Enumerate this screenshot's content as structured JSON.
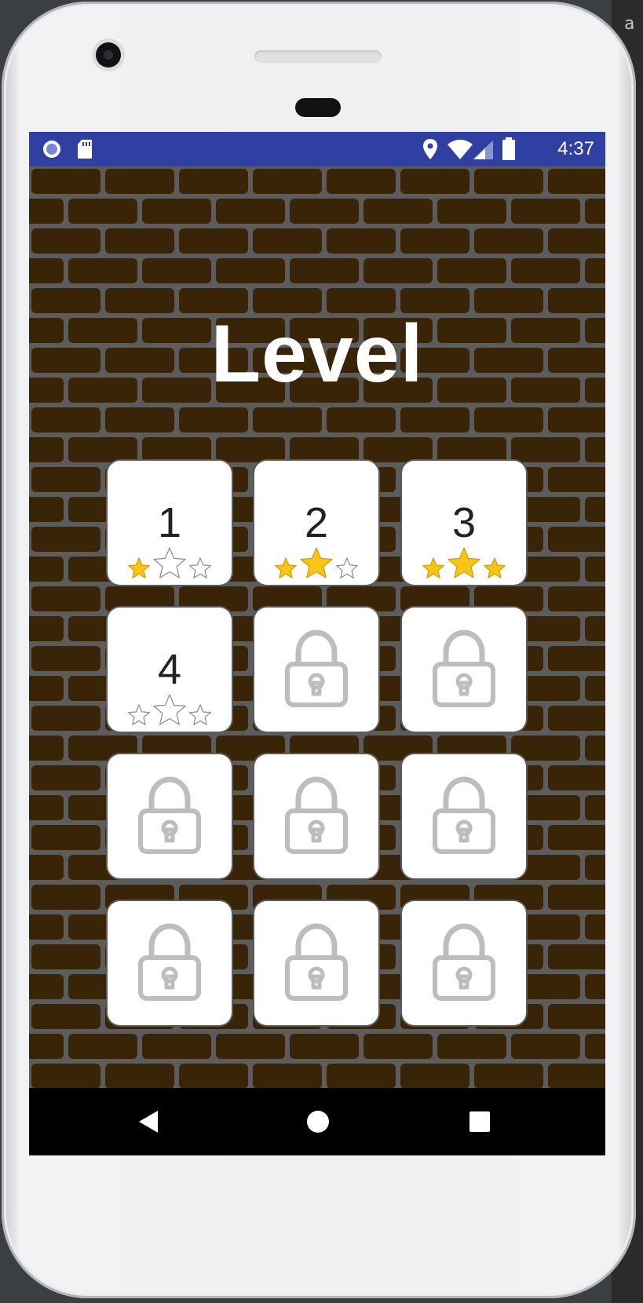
{
  "status_bar": {
    "time": "4:37",
    "icons": [
      "notification-circle-icon",
      "sd-card-icon",
      "location-icon",
      "wifi-icon",
      "signal-icon",
      "battery-icon"
    ]
  },
  "screen": {
    "title": "Level"
  },
  "levels": [
    {
      "label": "1",
      "locked": false,
      "stars": 1
    },
    {
      "label": "2",
      "locked": false,
      "stars": 2
    },
    {
      "label": "3",
      "locked": false,
      "stars": 3
    },
    {
      "label": "4",
      "locked": false,
      "stars": 0
    },
    {
      "label": "",
      "locked": true
    },
    {
      "label": "",
      "locked": true
    },
    {
      "label": "",
      "locked": true
    },
    {
      "label": "",
      "locked": true
    },
    {
      "label": "",
      "locked": true
    },
    {
      "label": "",
      "locked": true
    },
    {
      "label": "",
      "locked": true
    },
    {
      "label": "",
      "locked": true
    }
  ],
  "nav_bar": {
    "buttons": [
      "back-icon",
      "home-icon",
      "recents-icon"
    ]
  },
  "colors": {
    "status_bar": "#2f3fa2",
    "brick": "#3a2408",
    "mortar": "#5c5c5c",
    "star_gold": "#f5c518",
    "lock_gray": "#bdbdbd"
  }
}
